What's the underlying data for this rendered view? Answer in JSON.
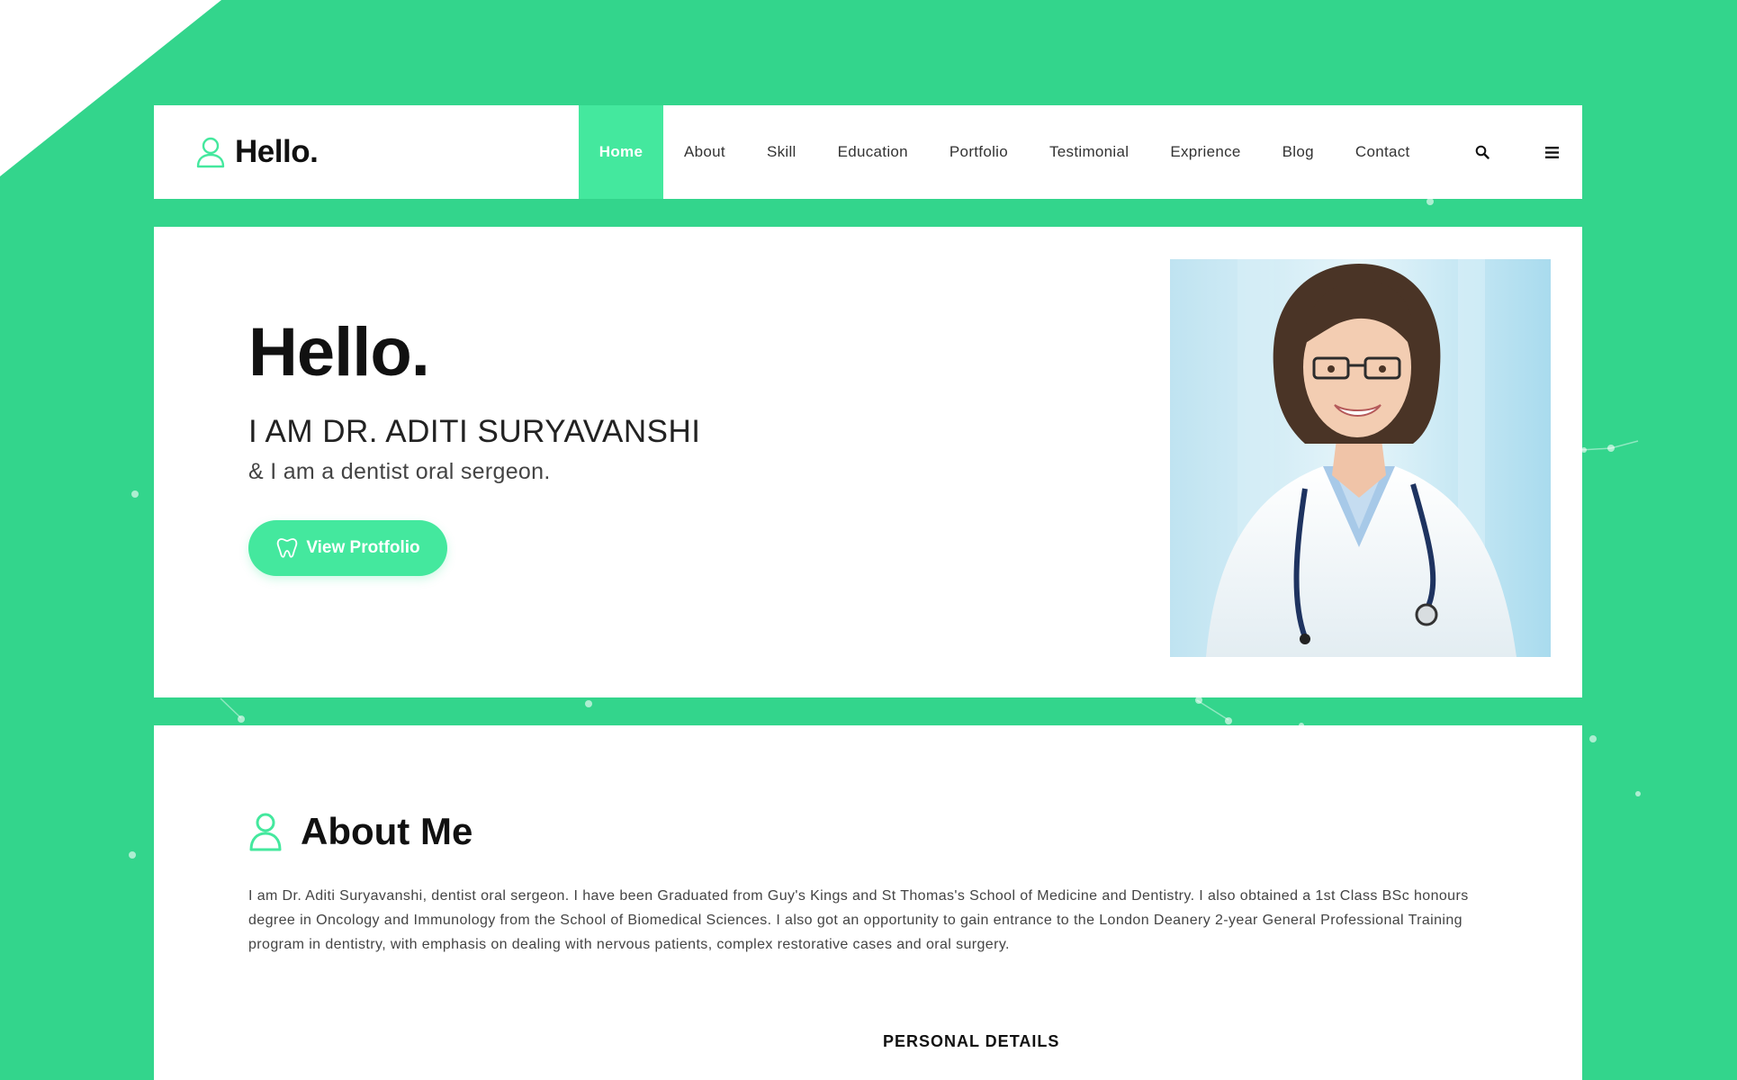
{
  "colors": {
    "background": "#33d58c",
    "accent": "#44e89e",
    "card": "#ffffff",
    "text_dark": "#111111"
  },
  "header": {
    "brand": {
      "icon": "user-outline-icon",
      "text": "Hello."
    },
    "nav": [
      {
        "label": "Home",
        "active": true
      },
      {
        "label": "About"
      },
      {
        "label": "Skill"
      },
      {
        "label": "Education"
      },
      {
        "label": "Portfolio"
      },
      {
        "label": "Testimonial"
      },
      {
        "label": "Exprience"
      },
      {
        "label": "Blog"
      },
      {
        "label": "Contact"
      }
    ],
    "icons": {
      "search": "search-icon",
      "menu": "hamburger-menu-icon"
    }
  },
  "hero": {
    "title": "Hello.",
    "name": "I AM DR. ADITI SURYAVANSHI",
    "subtitle": "& I am a dentist oral sergeon.",
    "button": {
      "label": "View Protfolio",
      "icon": "tooth-icon"
    },
    "photo": "doctor-portrait"
  },
  "about": {
    "icon": "user-outline-icon",
    "title": "About Me",
    "text": "I am Dr. Aditi Suryavanshi, dentist oral sergeon. I have been Graduated from Guy's Kings and St Thomas's School of Medicine and Dentistry. I also obtained a 1st Class BSc honours degree in Oncology and Immunology from the School of Biomedical Sciences. I also got an opportunity to gain entrance to the London Deanery 2-year General Professional Training program in dentistry, with emphasis on dealing with nervous patients, complex restorative cases and oral surgery.",
    "personal_details_title": "PERSONAL DETAILS"
  }
}
